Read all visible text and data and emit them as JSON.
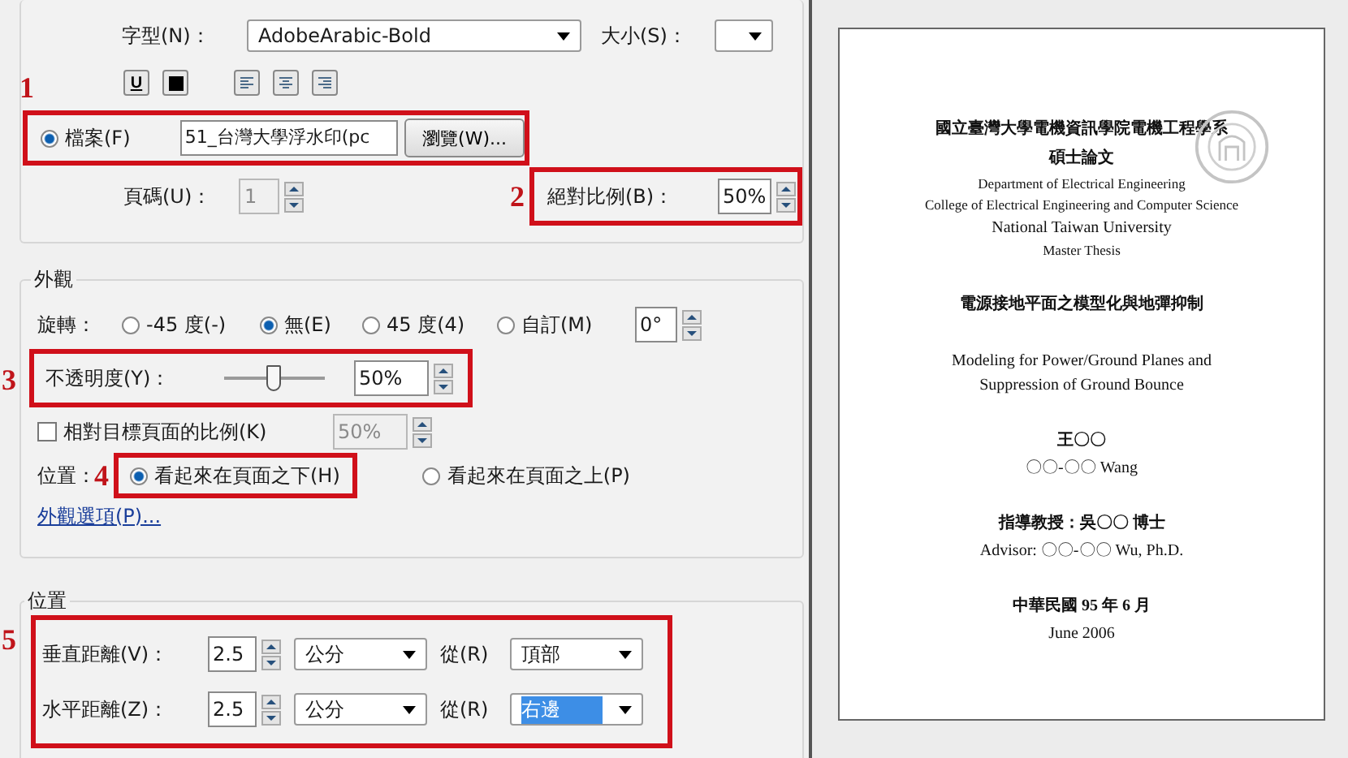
{
  "source": {
    "font_label": "字型(N)：",
    "font": "AdobeArabic-Bold",
    "size_label": "大小(S)：",
    "format_buttons": [
      {
        "kind": "underline",
        "label": "U"
      },
      {
        "kind": "color"
      },
      {
        "kind": "align_left"
      },
      {
        "kind": "align_center"
      },
      {
        "kind": "align_right"
      }
    ],
    "file_marker": "1",
    "file_option": {
      "label": "檔案(F)",
      "selected": true,
      "value": "51_台灣大學浮水印(pc",
      "browse": "瀏覽(W)..."
    },
    "page": {
      "label": "頁碼(U)：",
      "value": "1",
      "disabled": true
    },
    "scale_marker": "2",
    "absolute_scale": {
      "label": "絕對比例(B)：",
      "value": "50%"
    }
  },
  "appearance": {
    "title": "外觀",
    "rotation_label": "旋轉：",
    "rotations": [
      {
        "label": "-45 度(-)",
        "selected": false
      },
      {
        "label": "無(E)",
        "selected": true
      },
      {
        "label": "45 度(4)",
        "selected": false
      },
      {
        "label": "自訂(M)",
        "selected": false
      }
    ],
    "custom_angle": "0°",
    "opacity_marker": "3",
    "opacity": {
      "label": "不透明度(Y)：",
      "level": 0.5,
      "value": "50%"
    },
    "relative_scale": {
      "label": "相對目標頁面的比例(K)",
      "checked": false,
      "value": "50%"
    },
    "position_label": "位置：",
    "layer_marker": "4",
    "layers": [
      {
        "label": "看起來在頁面之下(H)",
        "selected": true
      },
      {
        "label": "看起來在頁面之上(P)",
        "selected": false
      }
    ],
    "options_link": "外觀選項(P)..."
  },
  "position": {
    "title": "位置",
    "marker": "5",
    "rows": [
      {
        "label": "垂直距離(V)：",
        "value": "2.5",
        "unit": "公分",
        "from_label": "從(R)",
        "from": "頂部",
        "focused": false
      },
      {
        "label": "水平距離(Z)：",
        "value": "2.5",
        "unit": "公分",
        "from_label": "從(R)",
        "from": "右邊",
        "focused": true
      }
    ]
  },
  "preview": {
    "blocks": [
      {
        "lines": [
          {
            "text": "國立臺灣大學電機資訊學院電機工程學系",
            "kind": "zh"
          },
          {
            "text": "碩士論文",
            "kind": "zh"
          },
          {
            "text": "Department of Electrical Engineering",
            "kind": "small"
          },
          {
            "text": "College of Electrical Engineering and Computer Science",
            "kind": "small"
          },
          {
            "text": "National Taiwan University",
            "kind": "en"
          },
          {
            "text": "Master Thesis",
            "kind": "small"
          }
        ]
      },
      {
        "lines": [
          {
            "text": "電源接地平面之模型化與地彈抑制",
            "kind": "zh"
          }
        ]
      },
      {
        "lines": [
          {
            "text": "Modeling for Power/Ground Planes and",
            "kind": "en"
          },
          {
            "text": "Suppression of Ground Bounce",
            "kind": "en"
          }
        ]
      },
      {
        "lines": [
          {
            "text": "王〇〇",
            "kind": "zh"
          },
          {
            "text": "〇〇-〇〇  Wang",
            "kind": "en"
          }
        ]
      },
      {
        "lines": [
          {
            "text": "指導教授：吳〇〇 博士",
            "kind": "zh"
          },
          {
            "text": "Advisor: 〇〇-〇〇  Wu, Ph.D.",
            "kind": "en"
          }
        ]
      },
      {
        "lines": [
          {
            "text": "中華民國 95 年 6 月",
            "kind": "zh"
          },
          {
            "text": "June 2006",
            "kind": "en"
          }
        ]
      }
    ]
  }
}
